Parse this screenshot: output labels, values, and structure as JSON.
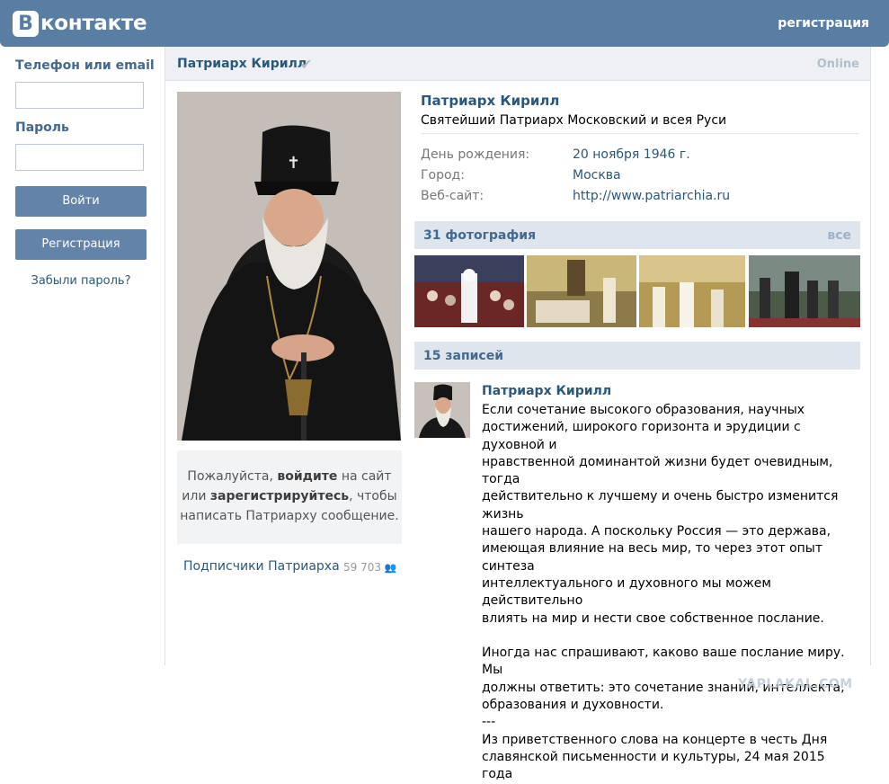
{
  "header": {
    "logo_letter": "В",
    "logo_text": "контакте",
    "register_link": "регистрация"
  },
  "login": {
    "phone_label": "Телефон или email",
    "phone_value": "",
    "password_label": "Пароль",
    "password_value": "",
    "login_button": "Войти",
    "register_button": "Регистрация",
    "forgot_link": "Забыли пароль?"
  },
  "page": {
    "title": "Патриарх Кирилл",
    "online": "Online"
  },
  "profile": {
    "name": "Патриарх Кирилл",
    "status": "Святейший Патриарх Московский и всея Руси",
    "info": [
      {
        "label": "День рождения:",
        "value": "20 ноября 1946 г."
      },
      {
        "label": "Город:",
        "value": "Москва"
      },
      {
        "label": "Веб-сайт:",
        "value": "http://www.patriarchia.ru"
      }
    ]
  },
  "message_box": {
    "text1": "Пожалуйста,",
    "login_link": "войдите",
    "text2": "на сайт",
    "text3": "или",
    "register_link": "зарегистрируйтесь",
    "text4": ", чтобы",
    "text5": "написать Патриарху сообщение."
  },
  "subscribers": {
    "label": "Подписчики Патриарха",
    "count": "59 703"
  },
  "photos": {
    "title": "31 фотография",
    "all_link": "все"
  },
  "posts": {
    "title": "15 записей",
    "author": "Патриарх Кирилл",
    "text": "Если сочетание высокого образования, научных\nдостижений, широкого горизонта и эрудиции с духовной и\nнравственной доминантой жизни будет очевидным, тогда\nдействительно к лучшему и очень быстро изменится жизнь\nнашего народа. А поскольку Россия — это держава,\nимеющая влияние на весь мир, то через этот опыт синтеза\nинтеллектуального и духовного мы можем действительно\nвлиять на мир и нести свое собственное послание.\n\nИногда нас спрашивают, каково ваше послание миру. Мы\nдолжны ответить: это сочетание знаний, интеллекта,\nобразования и духовности.\n---\nИз приветственного слова на концерте в честь Дня\nславянской письменности и культуры, 24 мая 2015 года"
  },
  "watermark": "YAPLAKAL.COM",
  "colors": {
    "brand_blue": "#597da3",
    "link_blue": "#2b587a",
    "button_blue": "#6383a8",
    "section_bg": "#dee5ec"
  }
}
